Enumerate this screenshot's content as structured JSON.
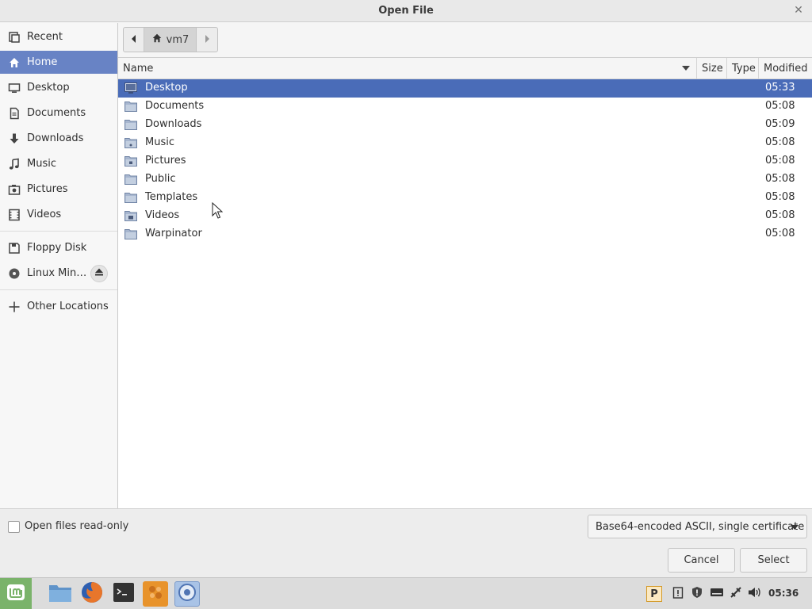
{
  "window": {
    "title": "Open File"
  },
  "sidebar": {
    "items": [
      {
        "label": "Recent",
        "icon": "recent-icon"
      },
      {
        "label": "Home",
        "icon": "home-icon",
        "active": true
      },
      {
        "label": "Desktop",
        "icon": "desktop-icon"
      },
      {
        "label": "Documents",
        "icon": "documents-icon"
      },
      {
        "label": "Downloads",
        "icon": "downloads-icon"
      },
      {
        "label": "Music",
        "icon": "music-icon"
      },
      {
        "label": "Pictures",
        "icon": "pictures-icon"
      },
      {
        "label": "Videos",
        "icon": "videos-icon"
      }
    ],
    "devices": [
      {
        "label": "Floppy Disk",
        "icon": "floppy-icon"
      },
      {
        "label": "Linux Min…",
        "icon": "disc-icon",
        "eject": true
      }
    ],
    "other": {
      "label": "Other Locations",
      "icon": "plus-icon"
    }
  },
  "pathbar": {
    "home_label": "vm7"
  },
  "columns": {
    "name": "Name",
    "size": "Size",
    "type": "Type",
    "modified": "Modified"
  },
  "files": [
    {
      "name": "Desktop",
      "modified": "05:33",
      "selected": true
    },
    {
      "name": "Documents",
      "modified": "05:08"
    },
    {
      "name": "Downloads",
      "modified": "05:09"
    },
    {
      "name": "Music",
      "modified": "05:08"
    },
    {
      "name": "Pictures",
      "modified": "05:08"
    },
    {
      "name": "Public",
      "modified": "05:08"
    },
    {
      "name": "Templates",
      "modified": "05:08"
    },
    {
      "name": "Videos",
      "modified": "05:08"
    },
    {
      "name": "Warpinator",
      "modified": "05:08"
    }
  ],
  "bottom": {
    "readonly_label": "Open files read-only",
    "filter_value": "Base64-encoded ASCII, single certificate",
    "cancel_label": "Cancel",
    "select_label": "Select"
  },
  "taskbar": {
    "clock": "05:36",
    "launchers": [
      "files-icon",
      "firefox-icon",
      "terminal-icon",
      "app-icon",
      "browser-icon"
    ],
    "tray": [
      "p-icon",
      "notes-icon",
      "shield-icon",
      "keyboard-icon",
      "network-icon",
      "volume-icon"
    ]
  },
  "colors": {
    "accent": "#6883c5",
    "selection": "#4a6cb8",
    "mint": "#7ab36a"
  }
}
